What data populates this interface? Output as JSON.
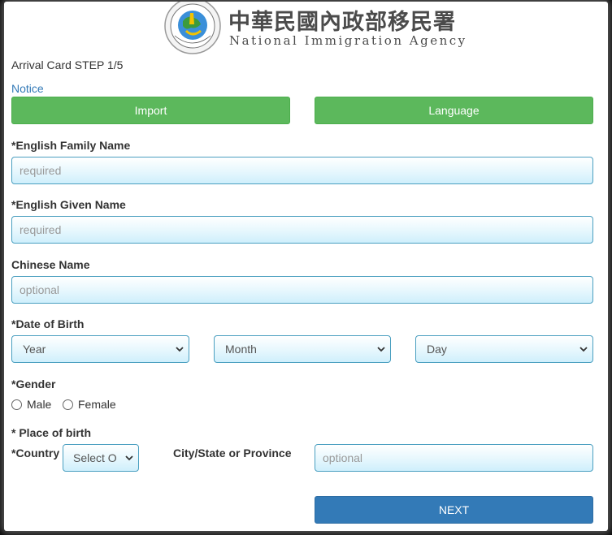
{
  "header": {
    "agency_cn": "中華民國內政部移民署",
    "agency_en": "National Immigration Agency",
    "logo_ring_text": "National Immigration Agency"
  },
  "step_label": "Arrival Card STEP 1/5",
  "notice_link": "Notice",
  "buttons": {
    "import": "Import",
    "language": "Language",
    "next": "NEXT"
  },
  "fields": {
    "family_name": {
      "label": "*English Family Name",
      "placeholder": "required"
    },
    "given_name": {
      "label": "*English Given Name",
      "placeholder": "required"
    },
    "chinese_name": {
      "label": "Chinese Name",
      "placeholder": "optional"
    },
    "dob": {
      "label": "*Date of Birth",
      "year": "Year",
      "month": "Month",
      "day": "Day"
    },
    "gender": {
      "label": "*Gender",
      "options": [
        "Male",
        "Female"
      ]
    },
    "place_of_birth": {
      "label": "* Place of birth",
      "country_label": "*Country",
      "country_value": "Select O",
      "city_label": "City/State or Province",
      "city_placeholder": "optional"
    }
  },
  "colors": {
    "primary_green": "#5cb85c",
    "primary_blue": "#337ab7",
    "field_border": "#4a9fc0",
    "link": "#337ab7"
  }
}
